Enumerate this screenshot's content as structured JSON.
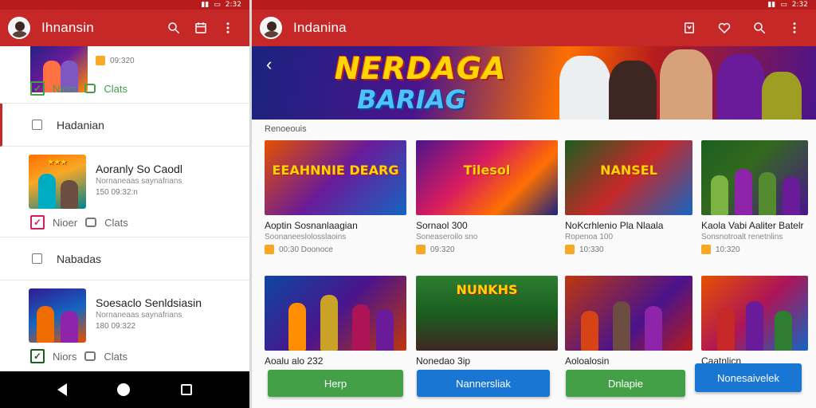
{
  "left": {
    "status": {
      "time": "2:32"
    },
    "appbar": {
      "title": "Ihnansin"
    },
    "list": [
      {
        "meta": "09:320",
        "check_label": "Niors",
        "chat_label": "Clats"
      },
      {
        "section": "Hadanian"
      },
      {
        "title": "Aoranly So Caodl",
        "subtitle": "Nornaneaas saynafrians",
        "meta": "150 09:32:n",
        "check_label": "Nioer",
        "chat_label": "Clats"
      },
      {
        "section": "Nabadas"
      },
      {
        "title": "Soesaclo Senldsiasin",
        "subtitle": "Nornaneaas saynafrians",
        "meta": "180 09:322",
        "check_label": "Niors",
        "chat_label": "Clats"
      }
    ]
  },
  "right": {
    "status": {
      "time": "2:32"
    },
    "appbar": {
      "title": "Indanina"
    },
    "banner": {
      "title": "NERDAGA",
      "subtitle": "BARIAG"
    },
    "section_label": "Renoeouis",
    "grid": [
      {
        "thumb_text": "EEAHNNIE DEARG",
        "title": "Aoptin Sosnanlaagian",
        "subtitle": "Soonaneeslolosslaoins",
        "meta": "00:30 Doonoce"
      },
      {
        "thumb_text": "Tilesol",
        "title": "Sornaol 300",
        "subtitle": "Soneaseroilo sno",
        "meta": "09:320"
      },
      {
        "thumb_text": "NANSEL",
        "title": "NoKcrhlenio Pla Nlaala",
        "subtitle": "Ropenoa 100",
        "meta": "10:330"
      },
      {
        "thumb_text": "",
        "title": "Kaola Vabi Aaliter Batelr",
        "subtitle": "Sonsnotroalt renetnlins",
        "meta": "10:320"
      },
      {
        "thumb_text": "",
        "title": "Aoalu alo 232",
        "subtitle": "",
        "meta": ""
      },
      {
        "thumb_text": "NUNKHS",
        "title": "Nonedao 3ip",
        "subtitle": "",
        "meta": ""
      },
      {
        "thumb_text": "",
        "title": "Aoloalosin",
        "subtitle": "",
        "meta": ""
      },
      {
        "thumb_text": "",
        "title": "Caatnlicn",
        "subtitle": "",
        "meta": ""
      }
    ],
    "buttons": [
      {
        "label": "Herp",
        "color": "#43a047"
      },
      {
        "label": "Nannersliak",
        "color": "#1976d2"
      },
      {
        "label": "Dnlapie",
        "color": "#43a047"
      },
      {
        "label": "Nonesaivelek",
        "color": "#1976d2"
      }
    ]
  },
  "colors": {
    "appbar": "#c62828",
    "statusbar": "#b71c1c",
    "accent_green": "#43a047",
    "accent_blue": "#1976d2"
  },
  "icons": [
    "search-icon",
    "calendar-icon",
    "more-vert-icon",
    "bookmark-icon",
    "heart-icon",
    "back-icon",
    "home-icon",
    "recent-apps-icon"
  ]
}
